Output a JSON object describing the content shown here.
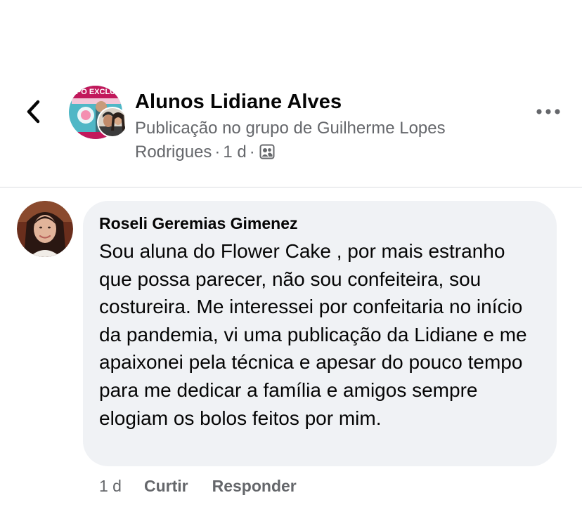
{
  "header": {
    "group_name": "Alunos Lidiane Alves",
    "subtitle_line1": "Publicação no grupo de Guilherme Lopes",
    "author_tail": "Rodrigues",
    "separator": "·",
    "time": "1 d",
    "group_avatar_text": "PO EXCLU",
    "icons": {
      "back": "back-chevron-icon",
      "privacy": "group-members-icon",
      "more": "more-options-icon"
    }
  },
  "comment": {
    "author": "Roseli Geremias Gimenez",
    "text": "Sou aluna do Flower Cake , por mais estranho que possa parecer, não sou confeiteira, sou costureira. Me interessei por confeitaria no início da pandemia, vi uma publicação da Lidiane e me apaixonei pela técnica e apesar do pouco tempo para me dedicar a família e amigos sempre elogiam os bolos feitos por mim.",
    "time": "1 d",
    "like_label": "Curtir",
    "reply_label": "Responder"
  },
  "colors": {
    "primary_text": "#050505",
    "secondary_text": "#65676b",
    "bubble_bg": "#f0f2f5",
    "divider": "#dadde1",
    "group_avatar_bg": "#4fb7c6",
    "group_avatar_ring": "#c2185b"
  }
}
